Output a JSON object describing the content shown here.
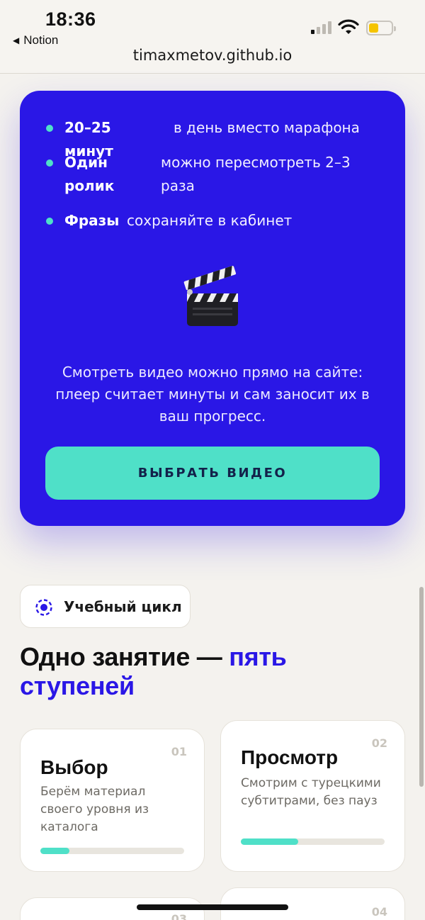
{
  "status": {
    "time": "18:36",
    "back_app": "Notion",
    "url": "timaxmetov.github.io",
    "signal_icon": "cellular-signal-icon",
    "wifi_icon": "wifi-icon",
    "battery_icon": "battery-low-icon",
    "battery_level": 0.35
  },
  "video_card": {
    "bullets": [
      {
        "bold": "20–25 минут",
        "text": "в день вместо марафона"
      },
      {
        "bold": "Один ролик",
        "text": "можно пересмотреть 2–3 раза"
      },
      {
        "bold": "Фразы",
        "text": "сохраняйте в кабинет"
      }
    ],
    "icon": "clapperboard-icon",
    "description": "Смотреть видео можно прямо на сайте: плеер считает минуты и сам заносит их в ваш прогресс.",
    "cta_label": "ВЫБРАТЬ ВИДЕО"
  },
  "section": {
    "chip_icon": "cycle-icon",
    "chip_label": "Учебный цикл",
    "heading_main": "Одно занятие — ",
    "heading_accent": "пять ступеней"
  },
  "steps": [
    {
      "num": "01",
      "title": "Выбор",
      "desc": "Берём материал своего уровня из каталога",
      "progress": 0.2
    },
    {
      "num": "02",
      "title": "Просмотр",
      "desc": "Смотрим с турецкими субтитрами, без пауз",
      "progress": 0.4
    },
    {
      "num": "03",
      "title": "",
      "desc": "",
      "progress": 0
    },
    {
      "num": "04",
      "title": "",
      "desc": "",
      "progress": 0
    }
  ],
  "colors": {
    "brand_blue": "#2a17e6",
    "accent_mint": "#4fe0c8",
    "background": "#f4f2ee"
  }
}
